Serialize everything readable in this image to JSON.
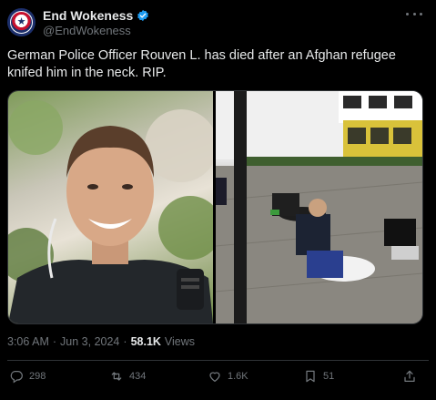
{
  "author": {
    "display_name": "End Wokeness",
    "handle": "@EndWokeness",
    "verified": true
  },
  "tweet": {
    "text": "German Police Officer Rouven L. has died after an Afghan refugee knifed him in the neck. RIP."
  },
  "meta": {
    "time": "3:06 AM",
    "dot1": "·",
    "date": "Jun 3, 2024",
    "dot2": "·",
    "views_count": "58.1K",
    "views_label": "Views"
  },
  "actions": {
    "replies": "298",
    "reposts": "434",
    "likes": "1.6K",
    "bookmarks": "51"
  },
  "colors": {
    "background": "#000000",
    "text": "#e7e9ea",
    "secondary": "#71767b",
    "verified": "#1d9bf0",
    "border": "#2f3336"
  },
  "icons": [
    "verified-badge-icon",
    "more-icon",
    "reply-icon",
    "repost-icon",
    "like-icon",
    "bookmark-icon",
    "share-icon"
  ]
}
